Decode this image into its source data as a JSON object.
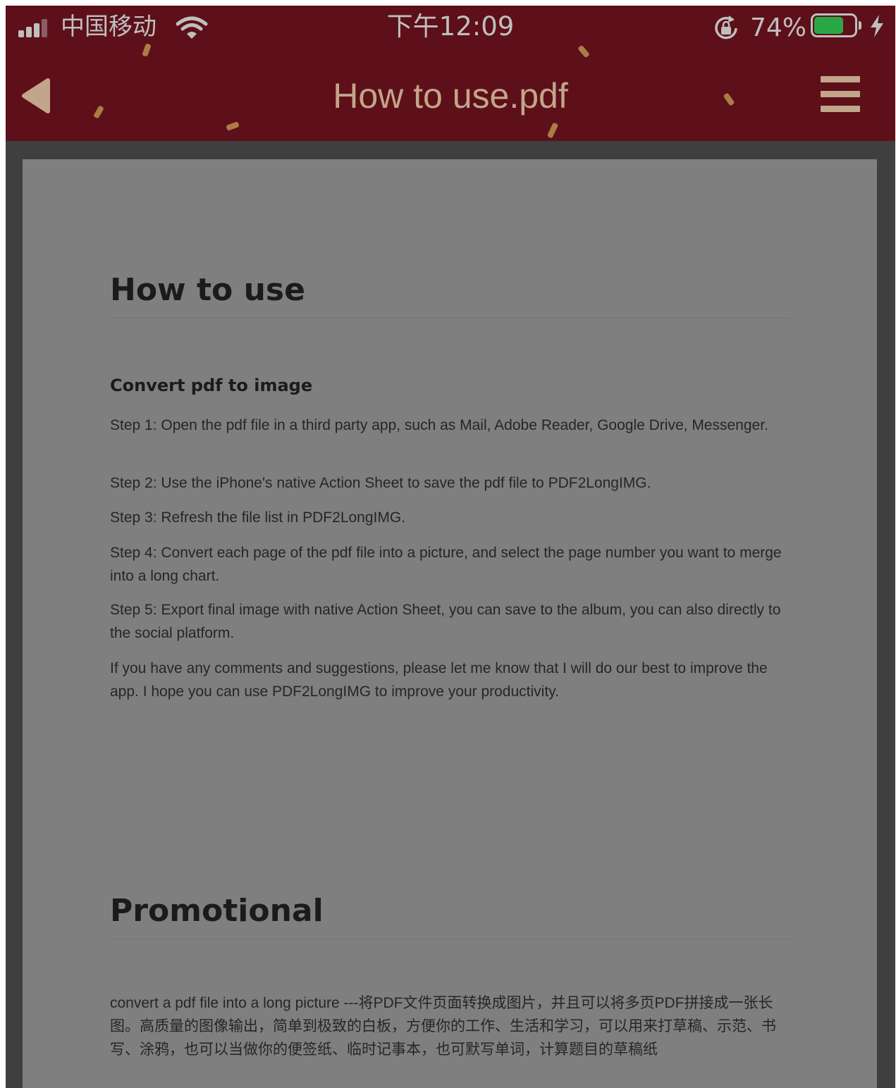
{
  "status_bar": {
    "carrier": "中国移动",
    "time": "下午12:09",
    "battery_percent": "74%",
    "battery_level": 0.74,
    "icons": [
      "signal-icon",
      "wifi-icon",
      "orientation-lock-icon",
      "battery-icon",
      "charging-icon"
    ]
  },
  "nav_bar": {
    "title": "How to use.pdf",
    "back_icon": "back-arrow-icon",
    "menu_icon": "hamburger-menu-icon",
    "title_color": "#c2a58a",
    "background_color": "#5d1019"
  },
  "document": {
    "sections": [
      {
        "heading": "How to use",
        "subheading": "Convert pdf to image",
        "paragraphs": [
          "Step 1: Open the pdf file in a third party app, such as Mail, Adobe Reader, Google Drive, Messenger.",
          "Step 2: Use the iPhone's native Action Sheet to save the pdf file to PDF2LongIMG.",
          "Step 3: Refresh the file list in PDF2LongIMG.",
          "Step 4: Convert each page of the pdf file into a picture, and select the page number you want to merge into a long chart.",
          "Step 5: Export final image with native Action Sheet, you can save to the album, you can also directly to the social platform.",
          "If you have any comments and suggestions, please let me know that I will do our best to improve the app. I hope you can use PDF2LongIMG to improve your productivity."
        ]
      },
      {
        "heading": "Promotional",
        "paragraphs": [
          "convert a pdf file into a long picture ---将PDF文件页面转换成图片，并且可以将多页PDF拼接成一张长图。高质量的图像输出，简单到极致的白板，方便你的工作、生活和学习，可以用来打草稿、示范、书写、涂鸦，也可以当做你的便签纸、临时记事本，也可默写单词，计算题目的草稿纸"
        ]
      }
    ]
  }
}
